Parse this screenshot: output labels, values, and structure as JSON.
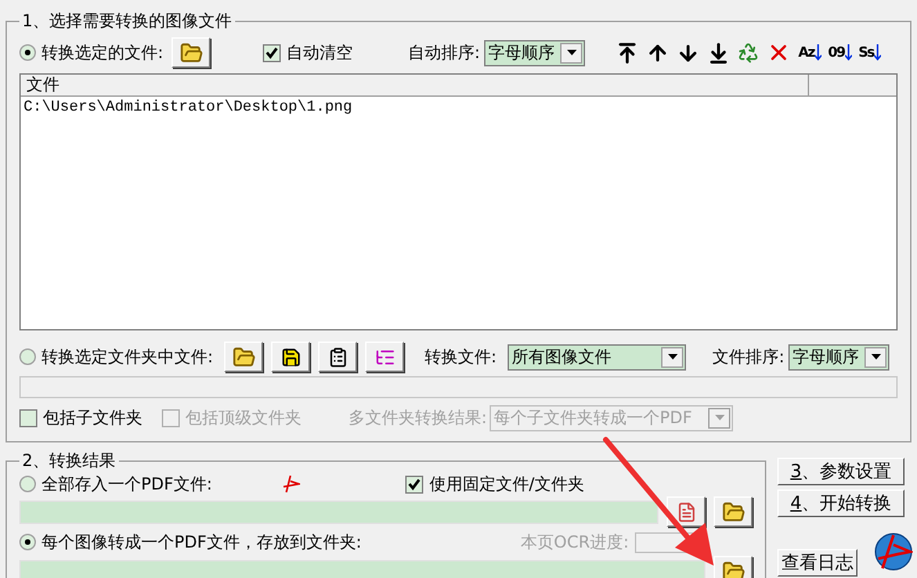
{
  "group1": {
    "title": "1、选择需要转换的图像文件",
    "file_mode": {
      "label": "转换选定的文件:",
      "selected": true
    },
    "auto_clear": {
      "label": "自动清空",
      "checked": true
    },
    "auto_sort": {
      "label": "自动排序:",
      "value": "字母顺序"
    },
    "sort_buttons": [
      {
        "label": "Az"
      },
      {
        "label": "09"
      },
      {
        "label": "Ss"
      }
    ],
    "file_list": {
      "columns": [
        "文件"
      ],
      "rows": [
        "C:\\Users\\Administrator\\Desktop\\1.png"
      ]
    },
    "folder_mode": {
      "label": "转换选定文件夹中文件:",
      "selected": false
    },
    "convert_files": {
      "label": "转换文件:",
      "value": "所有图像文件"
    },
    "file_sort": {
      "label": "文件排序:",
      "value": "字母顺序"
    },
    "include_subfolders": {
      "label": "包括子文件夹",
      "checked": false,
      "disabled": false
    },
    "include_top": {
      "label": "包括顶级文件夹",
      "checked": false,
      "disabled": true
    },
    "multi_result": {
      "label": "多文件夹转换结果:",
      "value": "每个子文件夹转成一个PDF",
      "disabled": true
    }
  },
  "group2": {
    "title": "2、转换结果",
    "single_pdf": {
      "label": "全部存入一个PDF文件:",
      "selected": false
    },
    "fixed": {
      "label": "使用固定文件/文件夹",
      "checked": true
    },
    "per_image": {
      "label": "每个图像转成一个PDF文件，存放到文件夹:",
      "selected": true
    },
    "ocr_label": "本页OCR进度:"
  },
  "buttons": [
    {
      "label": "3、参数设置",
      "accel": true
    },
    {
      "label": "4、开始转换",
      "accel": true
    },
    {
      "label": "查看日志",
      "accel": false
    }
  ]
}
